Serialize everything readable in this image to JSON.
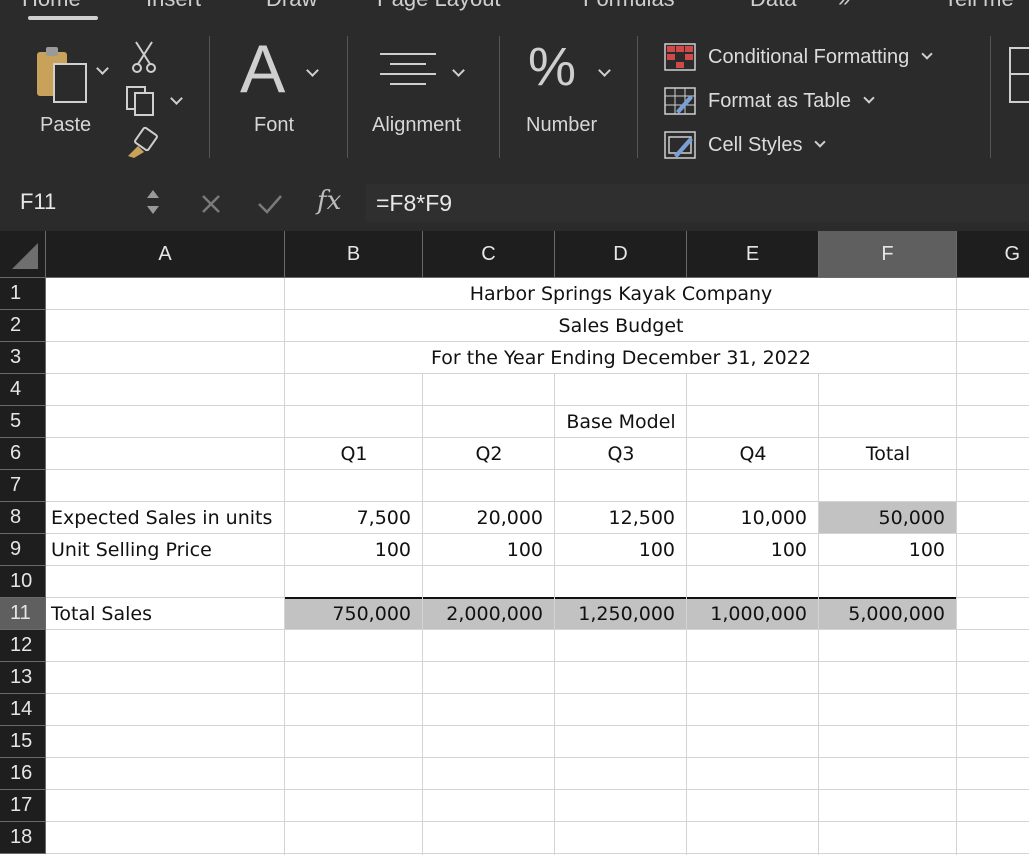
{
  "ribbon": {
    "tabs": [
      "Home",
      "Insert",
      "Draw",
      "Page Layout",
      "Formulas",
      "Data",
      "Tell me"
    ],
    "paste_label": "Paste",
    "font_label": "Font",
    "alignment_label": "Alignment",
    "number_label": "Number",
    "conditional_formatting": "Conditional Formatting",
    "format_as_table": "Format as Table",
    "cell_styles": "Cell Styles"
  },
  "formula_bar": {
    "name_box": "F11",
    "fx_symbol": "fx",
    "formula": "=F8*F9"
  },
  "grid": {
    "columns": [
      "A",
      "B",
      "C",
      "D",
      "E",
      "F",
      "G"
    ],
    "rows": [
      "1",
      "2",
      "3",
      "4",
      "5",
      "6",
      "7",
      "8",
      "9",
      "10",
      "11",
      "12",
      "13",
      "14",
      "15",
      "16",
      "17",
      "18"
    ],
    "selected_column": "F",
    "selected_row": "11",
    "title": "Harbor Springs Kayak Company",
    "subtitle": "Sales Budget",
    "period": "For the Year Ending December 31, 2022",
    "model": "Base Model",
    "quarters": [
      "Q1",
      "Q2",
      "Q3",
      "Q4",
      "Total"
    ],
    "expected_sales": {
      "label": "Expected Sales in units",
      "values": [
        "7,500",
        "20,000",
        "12,500",
        "10,000",
        "50,000"
      ]
    },
    "unit_price": {
      "label": "Unit Selling Price",
      "values": [
        "100",
        "100",
        "100",
        "100",
        "100"
      ]
    },
    "total_sales": {
      "label": "Total Sales",
      "values": [
        "750,000",
        "2,000,000",
        "1,250,000",
        "1,000,000",
        "5,000,000"
      ]
    }
  }
}
